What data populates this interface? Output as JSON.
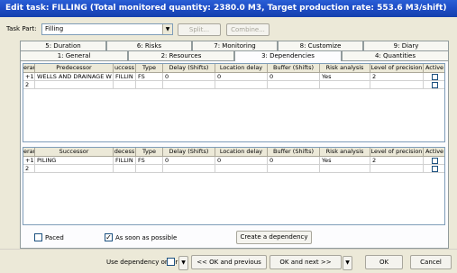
{
  "window": {
    "title": "Edit task: FILLING (Total monitored quantity: 2380.0 M3, Target production rate: 553.6 M3/shift)"
  },
  "task_part": {
    "label": "Task Part:",
    "value": "Filling"
  },
  "toolbar": {
    "split_label": "Split...",
    "combine_label": "Combine..."
  },
  "tabs_row1": [
    "5: Duration",
    "6: Risks",
    "7: Monitoring",
    "8: Customize",
    "9: Diary"
  ],
  "tabs_row2": [
    "1: General",
    "2: Resources",
    "3: Dependencies",
    "4: Quantities"
  ],
  "active_tab": "3: Dependencies",
  "predecessors": {
    "headers": [
      "erarcl",
      "Predecessor",
      "uccess",
      "Type",
      "Delay (Shifts)",
      "Location delay",
      "Buffer (Shifts)",
      "Risk analysis",
      "Level of precision",
      "Active"
    ],
    "rows": [
      {
        "hier": "+1",
        "name": "WELLS AND DRAINAGE W",
        "succ": "FILLIN",
        "type": "FS",
        "delay": "0",
        "loc_delay": "0",
        "buffer": "0",
        "risk": "Yes",
        "precision": "2"
      },
      {
        "hier": "2",
        "name": "",
        "succ": "",
        "type": "",
        "delay": "",
        "loc_delay": "",
        "buffer": "",
        "risk": "",
        "precision": ""
      }
    ]
  },
  "successors": {
    "headers": [
      "erarcl",
      "Successor",
      "decess",
      "Type",
      "Delay (Shifts)",
      "Location delay",
      "Buffer (Shifts)",
      "Risk analysis",
      "Level of precision",
      "Active"
    ],
    "rows": [
      {
        "hier": "+1",
        "name": "PILING",
        "pred": "FILLIN",
        "type": "FS",
        "delay": "0",
        "loc_delay": "0",
        "buffer": "0",
        "risk": "Yes",
        "precision": "2"
      },
      {
        "hier": "2",
        "name": "",
        "pred": "",
        "type": "",
        "delay": "",
        "loc_delay": "",
        "buffer": "",
        "risk": "",
        "precision": ""
      }
    ]
  },
  "options": {
    "paced_label": "Paced",
    "paced_checked": false,
    "asap_label": "As soon as possible",
    "asap_checked": true,
    "create_dep_label": "Create a dependency"
  },
  "footer": {
    "use_dep_order_label": "Use dependency order",
    "ok_prev_label": "<< OK and previous",
    "ok_next_label": "OK and next >>",
    "ok_label": "OK",
    "cancel_label": "Cancel"
  },
  "colors": {
    "titlebar": "#1d4cc4",
    "dialog_bg": "#ece9d8"
  }
}
